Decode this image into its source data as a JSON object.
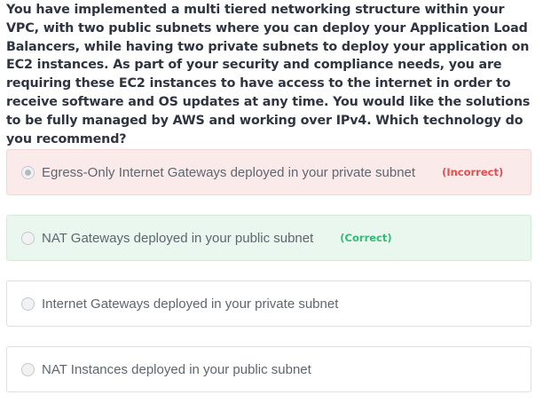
{
  "question": {
    "text": "You have implemented a multi tiered networking structure within your VPC, with two public subnets where you can deploy your Application Load Balancers, while having two private subnets to deploy your application on EC2 instances. As part of your security and compliance needs, you are requiring these EC2 instances to have access to the internet in order to receive software and OS updates at any time. You would like the solutions to be fully managed by AWS and working over IPv4. Which technology do you recommend?"
  },
  "options": [
    {
      "label": "Egress-Only Internet Gateways deployed in your private subnet",
      "selected": true,
      "status": "incorrect",
      "badge": "(Incorrect)"
    },
    {
      "label": "NAT Gateways deployed in your public subnet",
      "selected": false,
      "status": "correct",
      "badge": "(Correct)"
    },
    {
      "label": "Internet Gateways deployed in your private subnet",
      "selected": false,
      "status": "none",
      "badge": ""
    },
    {
      "label": "NAT Instances deployed in your public subnet",
      "selected": false,
      "status": "none",
      "badge": ""
    }
  ],
  "colors": {
    "incorrect_text": "#e05050",
    "incorrect_bg": "#fbeaea",
    "correct_text": "#33bb77",
    "correct_bg": "#e9f7ee"
  }
}
